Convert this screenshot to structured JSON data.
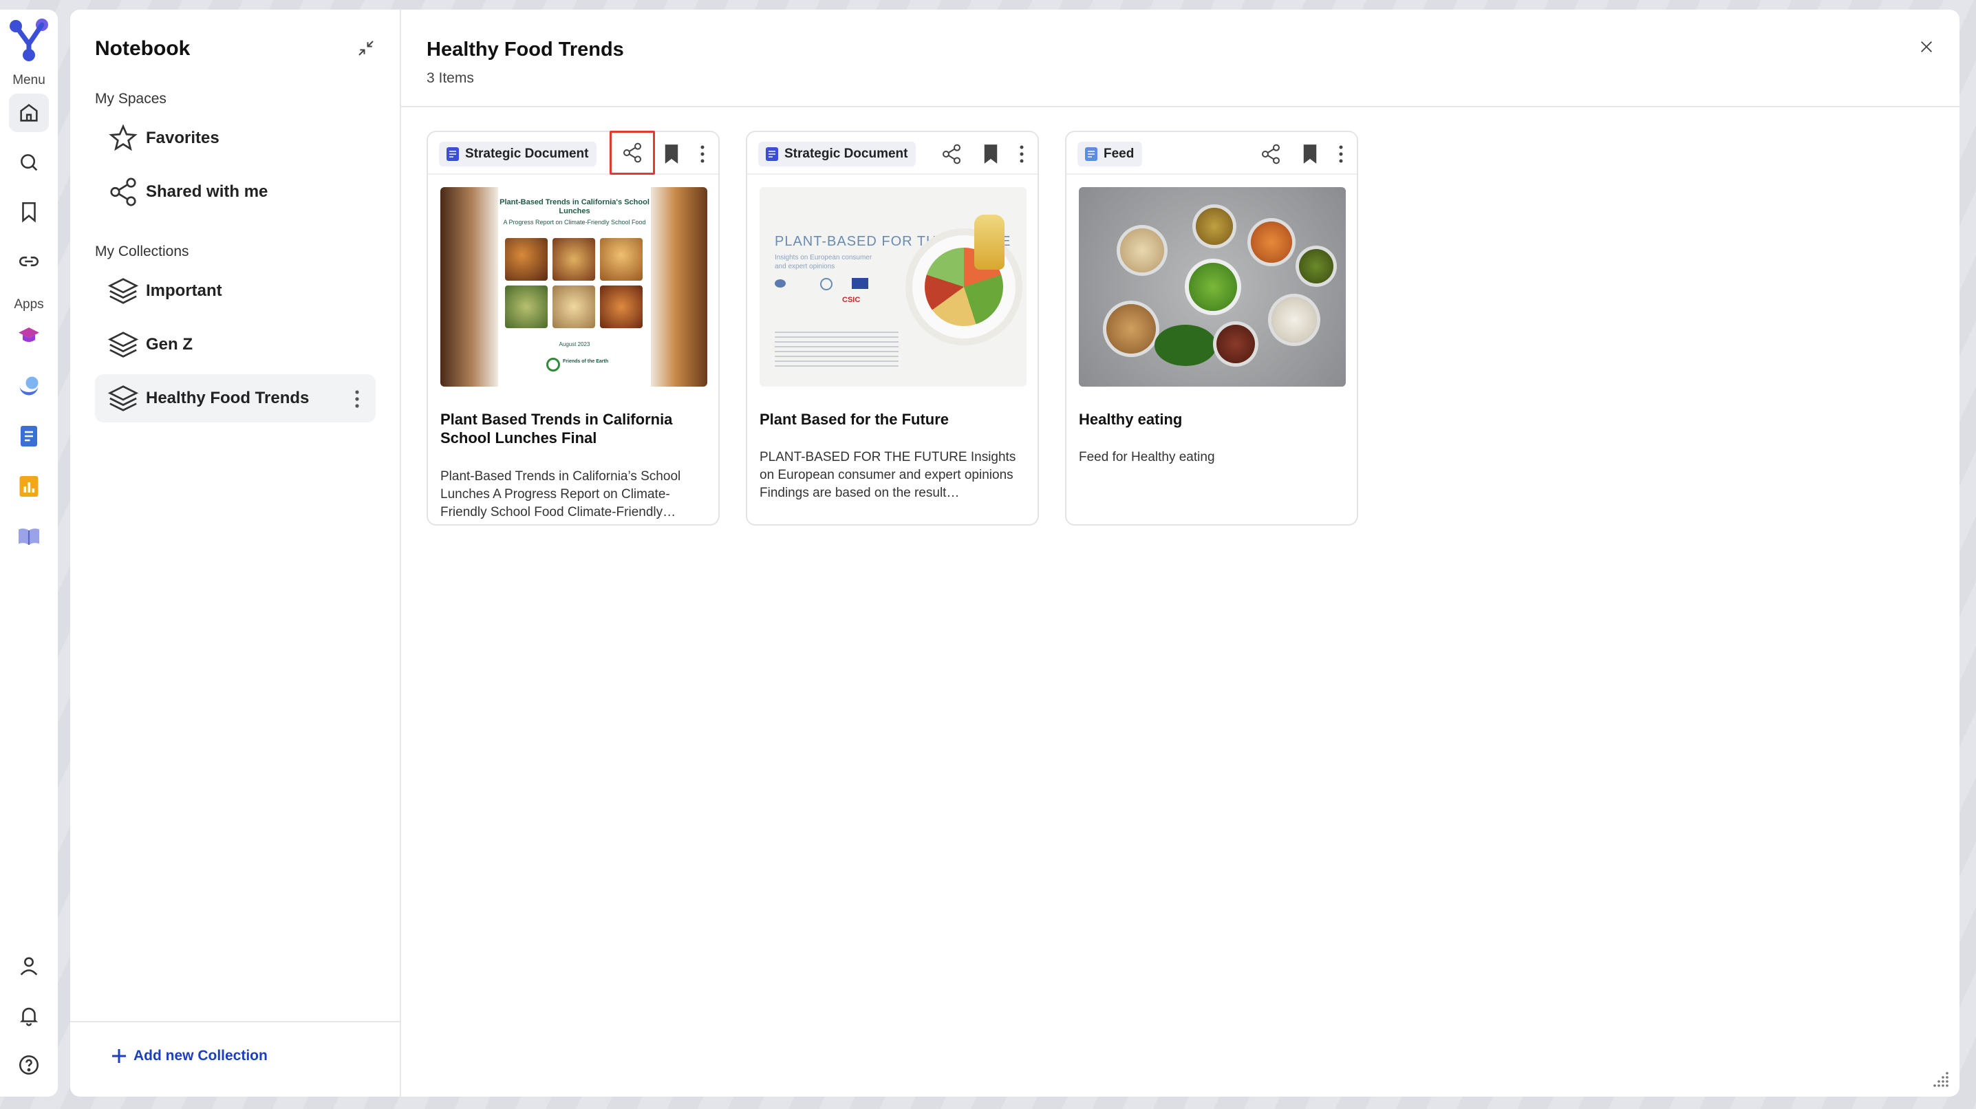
{
  "rail": {
    "menu_label": "Menu",
    "apps_label": "Apps"
  },
  "sidebar": {
    "title": "Notebook",
    "my_spaces_label": "My Spaces",
    "spaces": [
      {
        "label": "Favorites"
      },
      {
        "label": "Shared with me"
      }
    ],
    "my_collections_label": "My Collections",
    "collections": [
      {
        "label": "Important"
      },
      {
        "label": "Gen Z"
      },
      {
        "label": "Healthy Food Trends"
      }
    ],
    "add_collection_label": "Add new Collection"
  },
  "content": {
    "title": "Healthy Food Trends",
    "count": "3 Items",
    "cards": [
      {
        "tag": "Strategic Document",
        "title": "Plant Based Trends in California School Lunches Final",
        "description": "Plant-Based Trends in California’s School Lunches A Progress Report on Climate-Friendly School Food Climate-Friendly…",
        "thumb": {
          "heading": "Plant-Based Trends in California's School Lunches",
          "subheading": "A Progress Report on Climate-Friendly School Food",
          "date": "August 2023",
          "org": "Friends of the Earth"
        }
      },
      {
        "tag": "Strategic Document",
        "title": "Plant Based for the Future",
        "description": "PLANT-BASED FOR THE FUTURE Insights on European consumer and expert opinions Findings are based on the result…",
        "thumb": {
          "heading": "PLANT-BASED FOR THE FUTURE",
          "subheading": "Insights on European consumer and expert opinions",
          "logo_text": "CSIC"
        }
      },
      {
        "tag": "Feed",
        "title": "Healthy eating",
        "description": "Feed for Healthy eating"
      }
    ]
  },
  "colors": {
    "accent": "#1a3fbf",
    "highlight": "#e23b2e",
    "doc_tag_icon": "#3b4fd6",
    "feed_tag_icon": "#5b8de0"
  }
}
